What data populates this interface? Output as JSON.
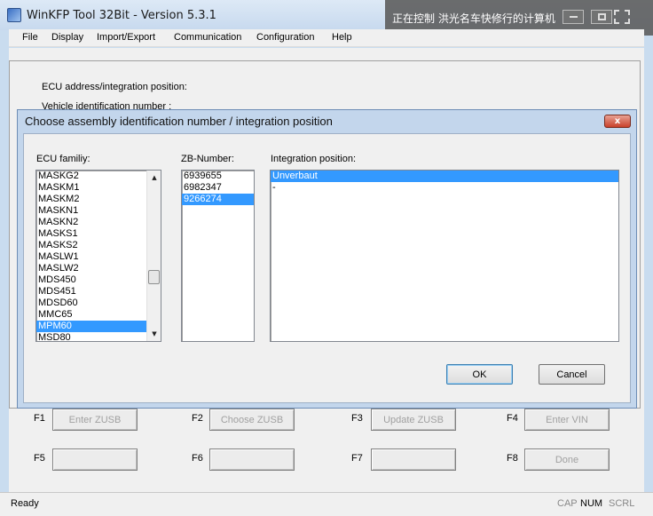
{
  "window": {
    "title": "WinKFP Tool 32Bit - Version 5.3.1"
  },
  "remote_control": {
    "label": "正在控制  洪光名车快修行的计算机"
  },
  "menu": [
    "File",
    "Display",
    "Import/Export",
    "Communication",
    "Configuration",
    "Help"
  ],
  "main": {
    "ecu_address_label": "ECU address/integration position:",
    "vin_label": "Vehicle identification number :"
  },
  "function_keys": [
    {
      "key": "F1",
      "label": "Enter ZUSB"
    },
    {
      "key": "F2",
      "label": "Choose ZUSB"
    },
    {
      "key": "F3",
      "label": "Update ZUSB"
    },
    {
      "key": "F4",
      "label": "Enter VIN"
    },
    {
      "key": "F5",
      "label": ""
    },
    {
      "key": "F6",
      "label": ""
    },
    {
      "key": "F7",
      "label": ""
    },
    {
      "key": "F8",
      "label": "Done"
    }
  ],
  "status_bar": {
    "text": "Ready",
    "indicators": [
      "CAP",
      "NUM",
      "SCRL"
    ]
  },
  "dialog": {
    "title": "Choose assembly identification number / integration position",
    "close_label": "x",
    "ecu_family_label": "ECU familiy:",
    "zb_number_label": "ZB-Number:",
    "integration_label": "Integration position:",
    "ecu_family_items": [
      "MASKG2",
      "MASKM1",
      "MASKM2",
      "MASKN1",
      "MASKN2",
      "MASKS1",
      "MASKS2",
      "MASLW1",
      "MASLW2",
      "MDS450",
      "MDS451",
      "MDSD60",
      "MMC65",
      "MPM60",
      "MSD80"
    ],
    "ecu_family_selected": "MPM60",
    "zb_numbers": [
      "6939655",
      "6982347",
      "9266274"
    ],
    "zb_selected": "9266274",
    "integration_positions": [
      "Unverbaut",
      "-"
    ],
    "integration_selected": "Unverbaut",
    "ok_label": "OK",
    "cancel_label": "Cancel"
  },
  "colors": {
    "selection": "#3399ff",
    "title_bar": "#c7d9ee",
    "dialog_frame": "#c3d6ec"
  }
}
